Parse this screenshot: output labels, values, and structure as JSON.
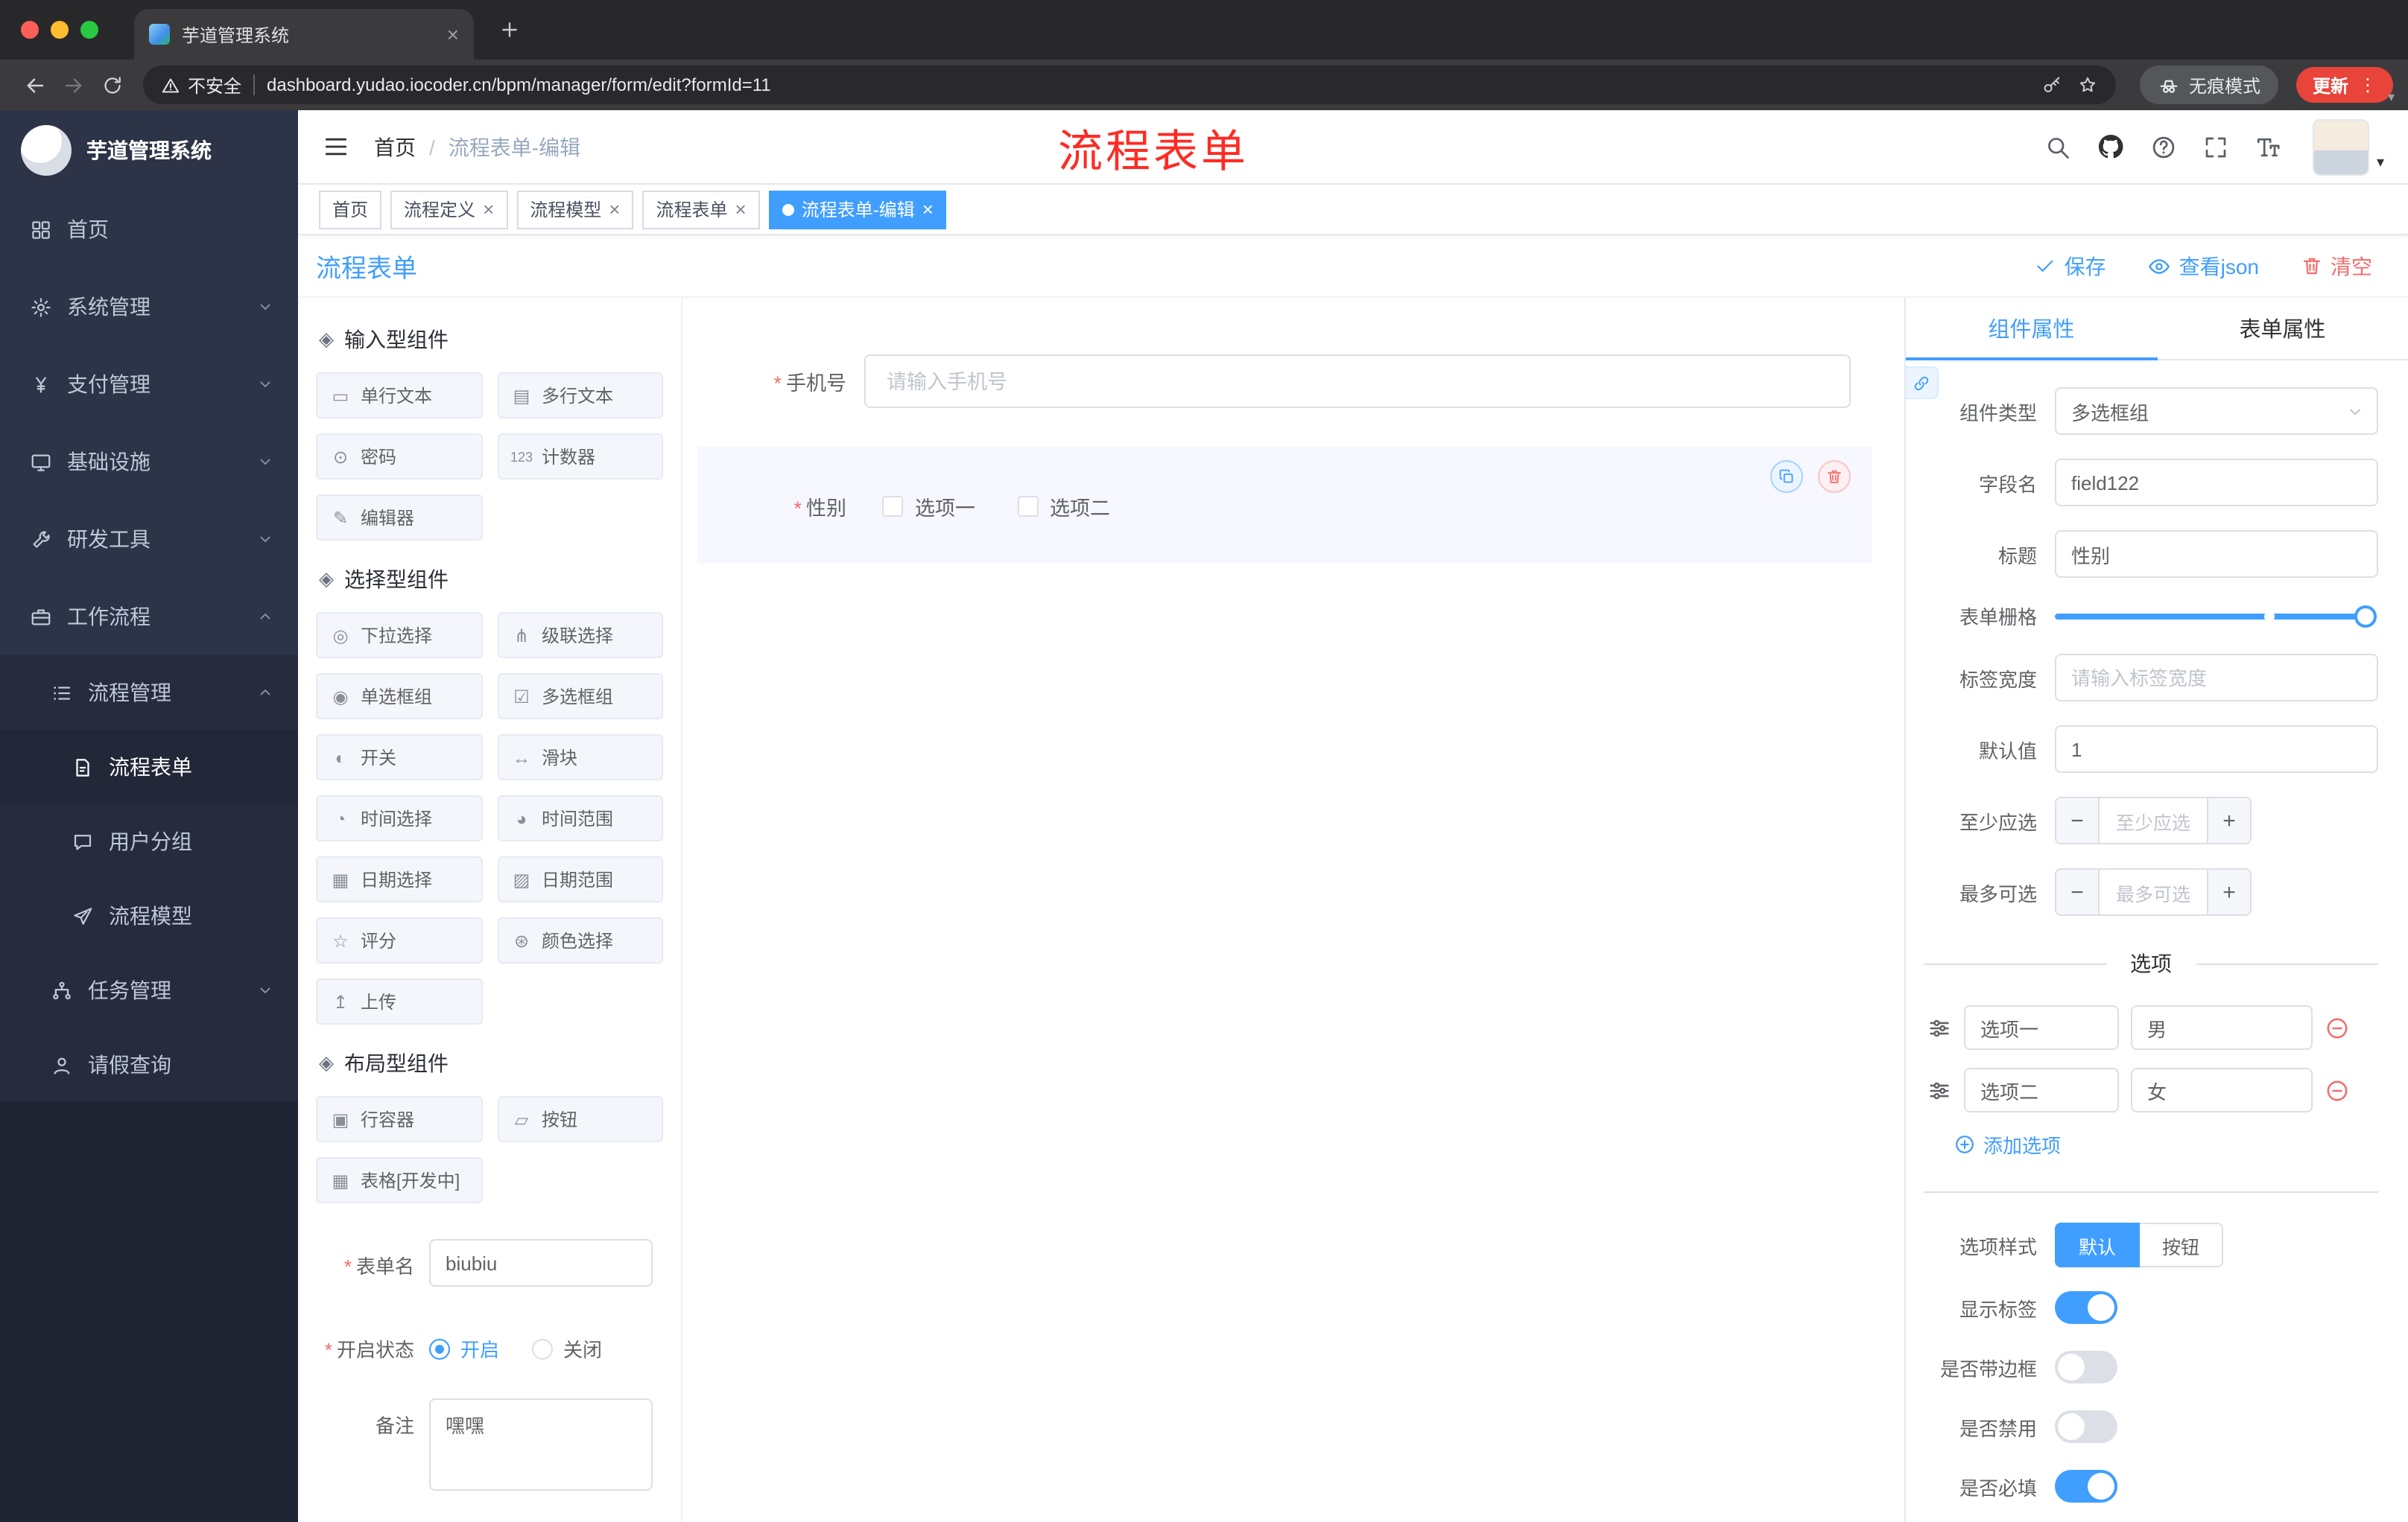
{
  "browser": {
    "tab_title": "芋道管理系统",
    "security_label": "不安全",
    "url": "dashboard.yudao.iocoder.cn/bpm/manager/form/edit?formId=11",
    "incognito_label": "无痕模式",
    "update_label": "更新"
  },
  "sidebar": {
    "logo_title": "芋道管理系统",
    "items": [
      {
        "label": "首页"
      },
      {
        "label": "系统管理"
      },
      {
        "label": "支付管理"
      },
      {
        "label": "基础设施"
      },
      {
        "label": "研发工具"
      },
      {
        "label": "工作流程"
      },
      {
        "label": "流程管理"
      },
      {
        "label": "流程表单"
      },
      {
        "label": "用户分组"
      },
      {
        "label": "流程模型"
      },
      {
        "label": "任务管理"
      },
      {
        "label": "请假查询"
      }
    ]
  },
  "header": {
    "breadcrumb": {
      "home": "首页",
      "separator": "/",
      "current": "流程表单-编辑"
    },
    "annotation": "流程表单"
  },
  "tags": [
    {
      "label": "首页"
    },
    {
      "label": "流程定义"
    },
    {
      "label": "流程模型"
    },
    {
      "label": "流程表单"
    },
    {
      "label": "流程表单-编辑"
    }
  ],
  "designer": {
    "title": "流程表单",
    "save": "保存",
    "view_json": "查看json",
    "clear": "清空"
  },
  "palette": {
    "sections": [
      {
        "title": "输入型组件",
        "items": [
          "单行文本",
          "多行文本",
          "密码",
          "计数器",
          "编辑器"
        ]
      },
      {
        "title": "选择型组件",
        "items": [
          "下拉选择",
          "级联选择",
          "单选框组",
          "多选框组",
          "开关",
          "滑块",
          "时间选择",
          "时间范围",
          "日期选择",
          "日期范围",
          "评分",
          "颜色选择",
          "上传"
        ]
      },
      {
        "title": "布局型组件",
        "items": [
          "行容器",
          "按钮",
          "表格[开发中]"
        ]
      }
    ],
    "form": {
      "name_label": "表单名",
      "name_value": "biubiu",
      "status_label": "开启状态",
      "status_on": "开启",
      "status_off": "关闭",
      "remark_label": "备注",
      "remark_value": "嘿嘿"
    }
  },
  "canvas": {
    "phone_label": "手机号",
    "phone_placeholder": "请输入手机号",
    "gender_label": "性别",
    "gender_options": [
      "选项一",
      "选项二"
    ]
  },
  "props": {
    "tab_component": "组件属性",
    "tab_form": "表单属性",
    "component_type_label": "组件类型",
    "component_type_value": "多选框组",
    "field_name_label": "字段名",
    "field_name_value": "field122",
    "title_label": "标题",
    "title_value": "性别",
    "grid_label": "表单栅格",
    "label_width_label": "标签宽度",
    "label_width_placeholder": "请输入标签宽度",
    "default_label": "默认值",
    "default_value": "1",
    "min_label": "至少应选",
    "min_placeholder": "至少应选",
    "max_label": "最多可选",
    "max_placeholder": "最多可选",
    "options_title": "选项",
    "options": [
      {
        "name": "选项一",
        "value": "男"
      },
      {
        "name": "选项二",
        "value": "女"
      }
    ],
    "add_option": "添加选项",
    "style_label": "选项样式",
    "style_default": "默认",
    "style_button": "按钮",
    "toggle_show_label": "显示标签",
    "toggle_border": "是否带边框",
    "toggle_disabled": "是否禁用",
    "toggle_required": "是否必填"
  },
  "icons": {
    "section": "◈",
    "single_text": "▭",
    "multi_text": "▤",
    "password": "⊙",
    "counter": "123",
    "editor": "✎",
    "select": "◎",
    "cascade": "⋔",
    "radio_group": "◉",
    "checkbox_group": "☑",
    "switch_comp": "◐",
    "slider_comp": "↔",
    "time": "◔",
    "time_range": "◕",
    "date": "▦",
    "date_range": "▨",
    "rate": "☆",
    "color": "⊛",
    "upload": "↥",
    "row": "▣",
    "button": "▱",
    "table": "▦",
    "close": "×",
    "dots_vertical": "⋮",
    "caret_down": "▾"
  },
  "colors": {
    "primary": "#409eff",
    "danger": "#f56c6c",
    "sidebar_bg": "#2d3447",
    "active_tag": "#409eff",
    "update_button": "#e8443a",
    "annotation_red": "#ff2b23"
  }
}
